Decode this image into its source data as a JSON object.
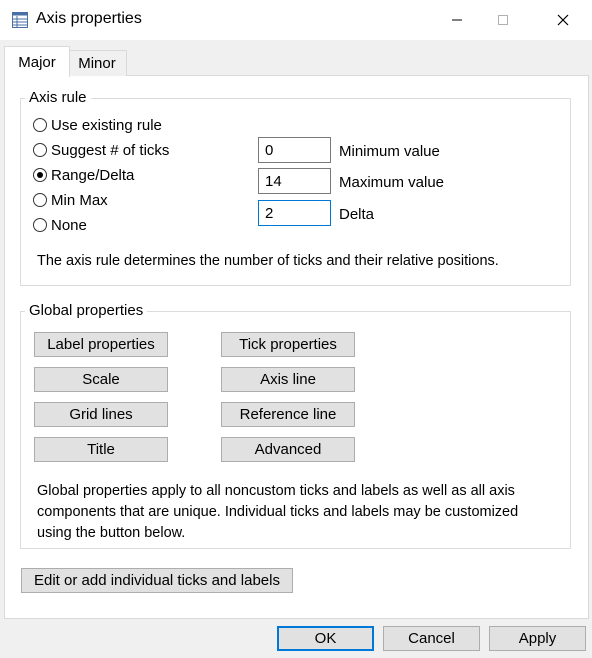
{
  "window": {
    "title": "Axis properties",
    "icon": "properties-table-icon",
    "controls": {
      "minimize": "—",
      "maximize": "☐",
      "close": "✕"
    }
  },
  "tabs": [
    {
      "label": "Major",
      "selected": true
    },
    {
      "label": "Minor",
      "selected": false
    }
  ],
  "axis_rule": {
    "title": "Axis rule",
    "options": [
      {
        "label": "Use existing rule",
        "checked": false
      },
      {
        "label": "Suggest # of ticks",
        "checked": false
      },
      {
        "label": "Range/Delta",
        "checked": true
      },
      {
        "label": "Min Max",
        "checked": false
      },
      {
        "label": "None",
        "checked": false
      }
    ],
    "fields": {
      "minimum": {
        "label": "Minimum value",
        "value": "0"
      },
      "maximum": {
        "label": "Maximum value",
        "value": "14"
      },
      "delta": {
        "label": "Delta",
        "value": "2"
      }
    },
    "description": "The axis rule determines the number of ticks and their relative positions."
  },
  "global_properties": {
    "title": "Global properties",
    "buttons": {
      "label_properties": "Label properties",
      "tick_properties": "Tick properties",
      "scale": "Scale",
      "axis_line": "Axis line",
      "grid_lines": "Grid lines",
      "reference_line": "Reference line",
      "title": "Title",
      "advanced": "Advanced"
    },
    "description": "Global properties apply to all noncustom ticks and labels as well as all axis components that are unique. Individual ticks and labels may be customized using the button below."
  },
  "edit_button": "Edit or add individual ticks and labels",
  "footer": {
    "ok": "OK",
    "cancel": "Cancel",
    "apply": "Apply"
  }
}
